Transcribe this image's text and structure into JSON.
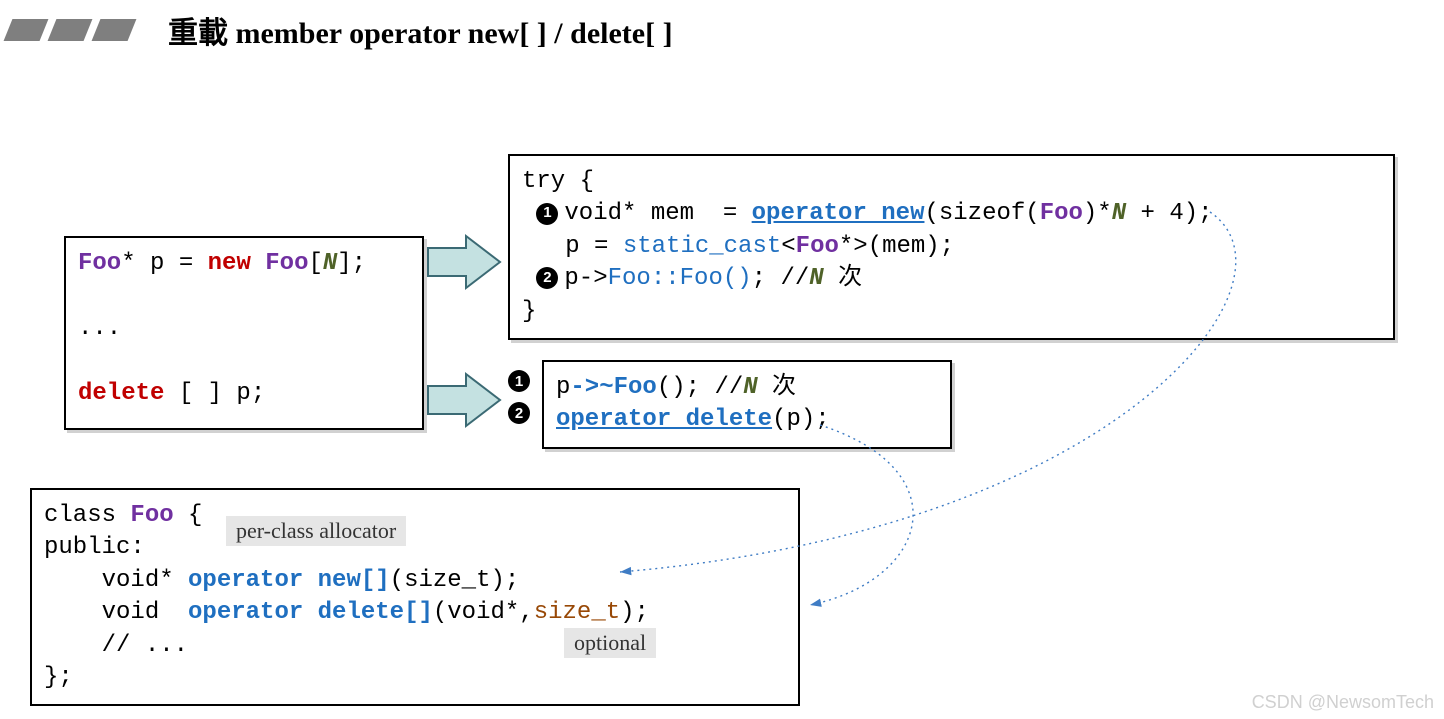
{
  "title": "重載 member operator new[ ] / delete[ ]",
  "box1_l1_a": "Foo",
  "box1_l1_b": "* p = ",
  "box1_l1_c": "new",
  "box1_l1_d": " Foo",
  "box1_l1_e": "[",
  "box1_l1_f": "N",
  "box1_l1_g": "];",
  "box1_l2": "...",
  "box1_l3_a": "delete",
  "box1_l3_b": " [ ] p;",
  "box2_l1": "try {",
  "box2_l2_b": "void* mem  = ",
  "box2_l2_c": "operator new",
  "box2_l2_d": "(sizeof(",
  "box2_l2_e": "Foo",
  "box2_l2_f": ")*",
  "box2_l2_g": "N",
  "box2_l2_h": " + 4);",
  "box2_l3_a": "   p = ",
  "box2_l3_b": "static_cast",
  "box2_l3_c": "<",
  "box2_l3_d": "Foo",
  "box2_l3_e": "*>(mem);",
  "box2_l4_b": "p->",
  "box2_l4_c": "Foo::Foo()",
  "box2_l4_d": "; //",
  "box2_l4_e": "N",
  "box2_l4_f": " 次",
  "box2_l5": "}",
  "box3_l1_a": "p",
  "box3_l1_b": "->~Foo",
  "box3_l1_c": "(); //",
  "box3_l1_d": "N",
  "box3_l1_e": " 次",
  "box3_l2_a": "operator delete",
  "box3_l2_b": "(p);",
  "box4_l1_a": "class ",
  "box4_l1_b": "Foo",
  "box4_l1_c": " {",
  "box4_l2": "public:",
  "box4_l3_a": "    void* ",
  "box4_l3_b": "operator new[]",
  "box4_l3_c": "(size_t);",
  "box4_l4_a": "    void  ",
  "box4_l4_b": "operator delete[]",
  "box4_l4_c": "(void*,",
  "box4_l4_d": "size_t",
  "box4_l4_e": ");",
  "box4_l5": "    // ...",
  "box4_l6": "};",
  "label_allocator": "per-class allocator",
  "label_optional": "optional",
  "watermark": "CSDN @NewsomTech",
  "b1": "1",
  "b2": "2"
}
